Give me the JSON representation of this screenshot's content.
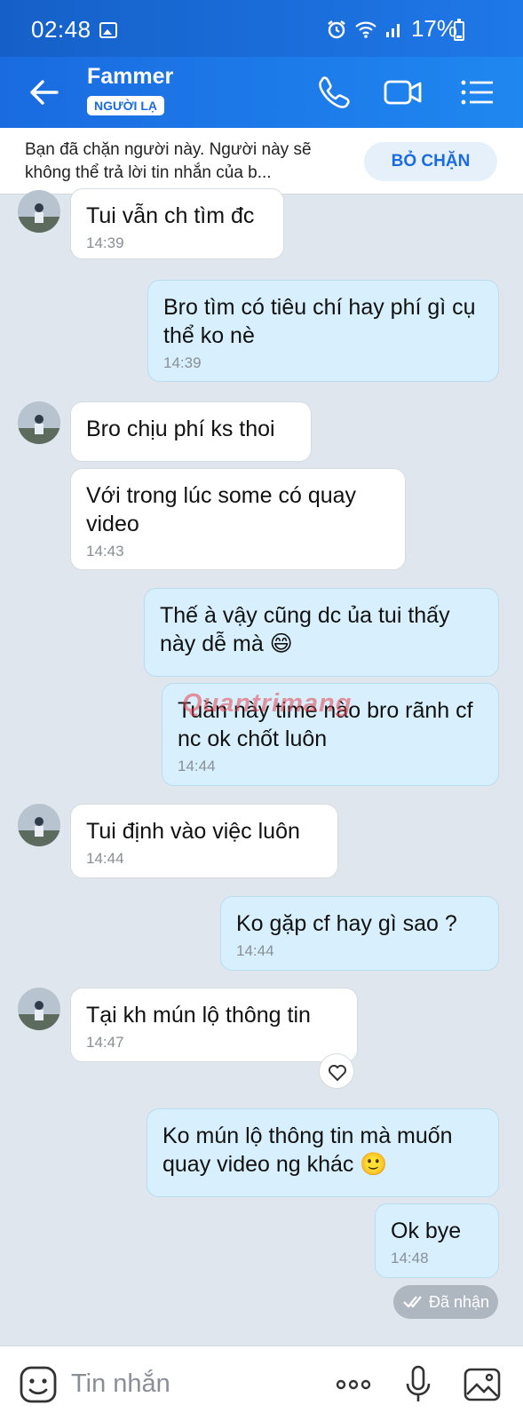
{
  "status_bar": {
    "time": "02:48",
    "battery": "17%"
  },
  "header": {
    "name": "Fammer",
    "badge": "NGƯỜI LẠ"
  },
  "banner": {
    "text": "Bạn đã chặn người này. Người này sẽ không thể trả lời tin nhắn của b...",
    "button": "BỎ CHẶN"
  },
  "messages": [
    {
      "dir": "in",
      "text": "Tui vẫn ch tìm đc",
      "time": "14:39"
    },
    {
      "dir": "out",
      "text": "Bro tìm có tiêu chí hay phí gì cụ thể ko nè",
      "time": "14:39"
    },
    {
      "dir": "in",
      "text": "Bro chịu phí ks thoi",
      "time": ""
    },
    {
      "dir": "in",
      "text": "Với trong lúc some có quay video",
      "time": "14:43"
    },
    {
      "dir": "out",
      "text": "Thế à vậy cũng dc ủa tui thấy này dễ mà 😄",
      "time": ""
    },
    {
      "dir": "out",
      "text": "Tuần này time nào bro rãnh cf nc ok chốt luôn",
      "time": "14:44"
    },
    {
      "dir": "in",
      "text": "Tui định vào việc luôn",
      "time": "14:44"
    },
    {
      "dir": "out",
      "text": "Ko gặp cf hay gì sao ?",
      "time": "14:44"
    },
    {
      "dir": "in",
      "text": "Tại kh mún lộ thông tin",
      "time": "14:47"
    },
    {
      "dir": "out",
      "text": "Ko mún lộ thông tin mà muốn quay video ng khác 🙂",
      "time": ""
    },
    {
      "dir": "out",
      "text": "Ok bye",
      "time": "14:48"
    }
  ],
  "watermark": "Quantrimang",
  "status": {
    "received": "Đã nhận"
  },
  "input": {
    "placeholder": "Tin nhắn"
  },
  "colors": {
    "accent": "#1a6be0",
    "outgoing_bubble": "#d8f0fd",
    "incoming_bubble": "#ffffff",
    "background": "#dfe6ee"
  }
}
